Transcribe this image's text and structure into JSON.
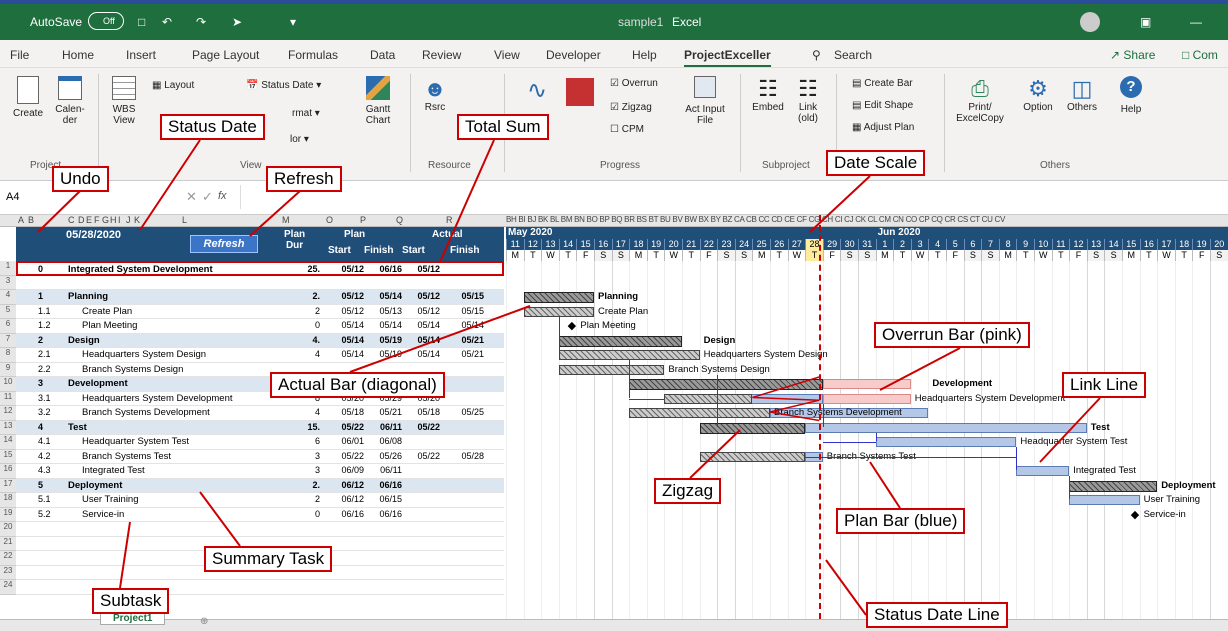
{
  "window": {
    "autosave": "AutoSave",
    "toggle": "Off",
    "filename": "sample1",
    "app": "Excel",
    "share": "Share",
    "comments": "Com"
  },
  "tabs": [
    "File",
    "Home",
    "Insert",
    "Page Layout",
    "Formulas",
    "Data",
    "Review",
    "View",
    "Developer",
    "Help",
    "ProjectExceller"
  ],
  "search": "Search",
  "ribbon": {
    "create": "Create",
    "calendar": "Calen-\nder",
    "wbs": "WBS\nView",
    "layout": "Layout",
    "status_date": "Status Date",
    "format": "rmat",
    "color": "lor",
    "gantt": "Gantt\nChart",
    "rsrc": "Rsrc",
    "overrun": "Overrun",
    "zigzag": "Zigzag",
    "cpm": "CPM",
    "act_input": "Act Input\nFile",
    "embed": "Embed",
    "link": "Link\n(old)",
    "create_bar": "Create Bar",
    "edit_shape": "Edit Shape",
    "adjust_plan": "Adjust Plan",
    "print": "Print/\nExcelCopy",
    "option": "Option",
    "others_btn": "Others",
    "help": "Help",
    "groups": {
      "project": "Project",
      "view": "View",
      "resource": "Resource",
      "progress": "Progress",
      "subproject": "Subproject",
      "others": "Others"
    }
  },
  "formula": {
    "namebox": "A4",
    "fx": "fx"
  },
  "sheet": {
    "col_letters": [
      "A",
      "B",
      "C",
      "D",
      "E",
      "F",
      "G",
      "H",
      "I",
      "J",
      "K",
      "L",
      "M",
      "O",
      "P",
      "Q",
      "R"
    ],
    "status_date": "05/28/2020",
    "refresh": "Refresh",
    "h_plan_dur": "Plan\nDur",
    "h_plan": "Plan",
    "h_start": "Start",
    "h_finish": "Finish",
    "h_actual": "Actual",
    "h_astart": "Start",
    "h_afinish": "Finish",
    "gantt_col_letters": "BH BI BJ BK BL BM BN BO BP BQ BR BS BT BU BV BW BX BY BZ CA CB CC CD CE CF CG CH CI CJ CK CL CM CN CO CP CQ CR CS CT CU CV",
    "month1": "May 2020",
    "month2": "Jun 2020",
    "days": [
      "11",
      "12",
      "13",
      "14",
      "15",
      "16",
      "17",
      "18",
      "19",
      "20",
      "21",
      "22",
      "23",
      "24",
      "25",
      "26",
      "27",
      "28",
      "29",
      "30",
      "31",
      "1",
      "2",
      "3",
      "4",
      "5",
      "6",
      "7",
      "8",
      "9",
      "10",
      "11",
      "12",
      "13",
      "14",
      "15",
      "16",
      "17",
      "18",
      "19",
      "20"
    ],
    "weekdays": [
      "M",
      "T",
      "W",
      "T",
      "F",
      "S",
      "S",
      "M",
      "T",
      "W",
      "T",
      "F",
      "S",
      "S",
      "M",
      "T",
      "W",
      "T",
      "F",
      "S",
      "S",
      "M",
      "T",
      "W",
      "T",
      "F",
      "S",
      "S",
      "M",
      "T",
      "W",
      "T",
      "F",
      "S",
      "S",
      "M",
      "T",
      "W",
      "T",
      "F",
      "S"
    ],
    "rows": [
      {
        "rn": "1",
        "id": "0",
        "name": "Integrated System Development",
        "dur": "25.",
        "ps": "05/12",
        "pf": "06/16",
        "as": "05/12",
        "af": "",
        "bold": true,
        "summary": true,
        "indent": 0
      },
      {
        "rn": "3",
        "id": "",
        "name": "",
        "dur": "",
        "ps": "",
        "pf": "",
        "as": "",
        "af": ""
      },
      {
        "rn": "4",
        "id": "1",
        "name": "Planning",
        "dur": "2.",
        "ps": "05/12",
        "pf": "05/14",
        "as": "05/12",
        "af": "05/15",
        "bold": true,
        "indent": 0
      },
      {
        "rn": "5",
        "id": "1.1",
        "name": "Create Plan",
        "dur": "2",
        "ps": "05/12",
        "pf": "05/13",
        "as": "05/12",
        "af": "05/15",
        "indent": 1
      },
      {
        "rn": "6",
        "id": "1.2",
        "name": "Plan Meeting",
        "dur": "0",
        "ps": "05/14",
        "pf": "05/14",
        "as": "05/14",
        "af": "05/14",
        "indent": 1
      },
      {
        "rn": "7",
        "id": "2",
        "name": "Design",
        "dur": "4.",
        "ps": "05/14",
        "pf": "05/19",
        "as": "05/14",
        "af": "05/21",
        "bold": true,
        "indent": 0
      },
      {
        "rn": "8",
        "id": "2.1",
        "name": "Headquarters System Design",
        "dur": "4",
        "ps": "05/14",
        "pf": "05/19",
        "as": "05/14",
        "af": "05/21",
        "indent": 1
      },
      {
        "rn": "9",
        "id": "2.2",
        "name": "Branch Systems Design",
        "dur": "",
        "ps": "",
        "pf": "",
        "as": "",
        "af": "",
        "indent": 1
      },
      {
        "rn": "10",
        "id": "3",
        "name": "Development",
        "dur": "",
        "ps": "",
        "pf": "",
        "as": "",
        "af": "",
        "bold": true,
        "indent": 0
      },
      {
        "rn": "11",
        "id": "3.1",
        "name": "Headquarters System Development",
        "dur": "8",
        "ps": "05/20",
        "pf": "05/29",
        "as": "05/20",
        "af": "",
        "indent": 1
      },
      {
        "rn": "12",
        "id": "3.2",
        "name": "Branch Systems Development",
        "dur": "4",
        "ps": "05/18",
        "pf": "05/21",
        "as": "05/18",
        "af": "05/25",
        "indent": 1
      },
      {
        "rn": "13",
        "id": "4",
        "name": "Test",
        "dur": "15.",
        "ps": "05/22",
        "pf": "06/11",
        "as": "05/22",
        "af": "",
        "bold": true,
        "indent": 0
      },
      {
        "rn": "14",
        "id": "4.1",
        "name": "Headquarter System Test",
        "dur": "6",
        "ps": "06/01",
        "pf": "06/08",
        "as": "",
        "af": "",
        "indent": 1
      },
      {
        "rn": "15",
        "id": "4.2",
        "name": "Branch Systems Test",
        "dur": "3",
        "ps": "05/22",
        "pf": "05/26",
        "as": "05/22",
        "af": "05/28",
        "indent": 1
      },
      {
        "rn": "16",
        "id": "4.3",
        "name": "Integrated Test",
        "dur": "3",
        "ps": "06/09",
        "pf": "06/11",
        "as": "",
        "af": "",
        "indent": 1
      },
      {
        "rn": "17",
        "id": "5",
        "name": "Deployment",
        "dur": "2.",
        "ps": "06/12",
        "pf": "06/16",
        "as": "",
        "af": "",
        "bold": true,
        "indent": 0
      },
      {
        "rn": "18",
        "id": "5.1",
        "name": "User Training",
        "dur": "2",
        "ps": "06/12",
        "pf": "06/15",
        "as": "",
        "af": "",
        "indent": 1
      },
      {
        "rn": "19",
        "id": "5.2",
        "name": "Service-in",
        "dur": "0",
        "ps": "06/16",
        "pf": "06/16",
        "as": "",
        "af": "",
        "indent": 1
      },
      {
        "rn": "20",
        "id": "",
        "name": "",
        "dur": "",
        "ps": "",
        "pf": "",
        "as": "",
        "af": ""
      },
      {
        "rn": "21",
        "id": "",
        "name": "",
        "dur": "",
        "ps": "",
        "pf": "",
        "as": "",
        "af": ""
      },
      {
        "rn": "22",
        "id": "",
        "name": "",
        "dur": "",
        "ps": "",
        "pf": "",
        "as": "",
        "af": ""
      },
      {
        "rn": "23",
        "id": "",
        "name": "",
        "dur": "",
        "ps": "",
        "pf": "",
        "as": "",
        "af": ""
      },
      {
        "rn": "24",
        "id": "",
        "name": "",
        "dur": "",
        "ps": "",
        "pf": "",
        "as": "",
        "af": ""
      }
    ],
    "gantt_labels": [
      "Planning",
      "Create Plan",
      "Plan Meeting",
      "Design",
      "Headquarters System Design",
      "Branch Systems Design",
      "Development",
      "Headquarters System Development",
      "Branch Systems Development",
      "Test",
      "Headquarter System Test",
      "Branch Systems Test",
      "Integrated Test",
      "Deployment",
      "User Training",
      "Service-in"
    ],
    "sheet_tab": "Project1"
  },
  "callouts": {
    "status_date": "Status Date",
    "total_sum": "Total Sum",
    "undo": "Undo",
    "refresh": "Refresh",
    "date_scale": "Date Scale",
    "overrun": "Overrun Bar (pink)",
    "link_line": "Link Line",
    "actual_bar": "Actual Bar (diagonal)",
    "zigzag": "Zigzag",
    "plan_bar": "Plan Bar (blue)",
    "summary_task": "Summary Task",
    "subtask": "Subtask",
    "status_line": "Status Date Line"
  },
  "colors": {
    "excel_green": "#1e6e3e",
    "header_navy": "#1f4e79",
    "summary_row": "#dce6f1",
    "plan_bar": "#b4c7e7",
    "overrun_bar": "#f8cbcb",
    "status_line": "#cc0000",
    "link_line": "#3333cc"
  }
}
